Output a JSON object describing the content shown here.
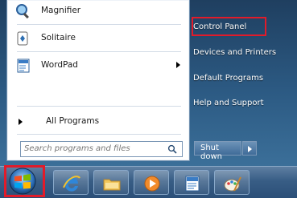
{
  "programs": [
    {
      "label": "Magnifier",
      "icon": "magnifier-icon"
    },
    {
      "label": "Solitaire",
      "icon": "solitaire-icon"
    },
    {
      "label": "WordPad",
      "icon": "wordpad-icon",
      "has_submenu": true
    }
  ],
  "all_programs": {
    "label": "All Programs"
  },
  "search": {
    "placeholder": "Search programs and files"
  },
  "right_pane": {
    "items": [
      {
        "label": "Control Panel",
        "highlighted": true
      },
      {
        "label": "Devices and Printers"
      },
      {
        "label": "Default Programs"
      },
      {
        "label": "Help and Support"
      }
    ]
  },
  "shutdown": {
    "label": "Shut down"
  },
  "taskbar": {
    "items": [
      {
        "name": "internet-explorer",
        "icon": "internet-explorer-icon"
      },
      {
        "name": "windows-explorer",
        "icon": "folder-icon"
      },
      {
        "name": "media-player",
        "icon": "media-player-icon"
      },
      {
        "name": "wordpad",
        "icon": "wordpad-icon"
      },
      {
        "name": "paint",
        "icon": "paint-icon"
      }
    ]
  },
  "colors": {
    "highlight_border": "#e11b2a",
    "taskbar": "#385d85",
    "menu_right_pane": "#2c5a83"
  }
}
